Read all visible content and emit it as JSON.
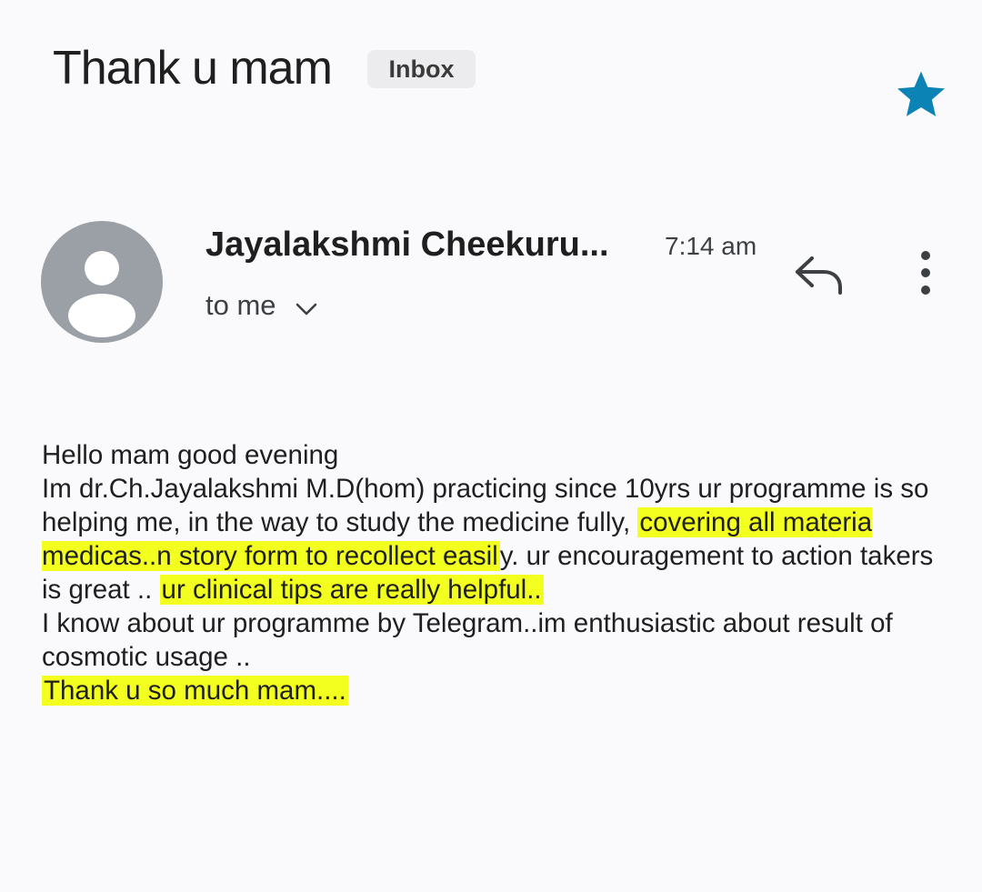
{
  "email": {
    "subject": "Thank u mam",
    "label": "Inbox",
    "starred": true,
    "star_color": "#0b84b5",
    "highlight_color": "#f2ff1f",
    "sender": "Jayalakshmi Cheekuru...",
    "time": "7:14 am",
    "recipients": "to me",
    "icons": {
      "avatar": "person-avatar-icon",
      "star": "star-icon",
      "reply": "reply-icon",
      "more": "more-vertical-icon",
      "expand": "chevron-down-icon"
    },
    "body": {
      "line1": "Hello mam good evening",
      "p2_a": "Im dr.Ch.Jayalakshmi M.D(hom) practicing since 10yrs ur programme is so helping me, in the way to study the medicine fully, ",
      "p2_hl1": "covering all materia medicas..n story form to recollect easil",
      "p2_b": "y. ur encouragement to action takers is great .. ",
      "p2_hl2": "ur clinical tips are really helpful..",
      "p3": "I know about ur programme by Telegram..im enthusiastic about result of cosmotic usage ..",
      "closing": "Thank u so much mam...."
    }
  }
}
